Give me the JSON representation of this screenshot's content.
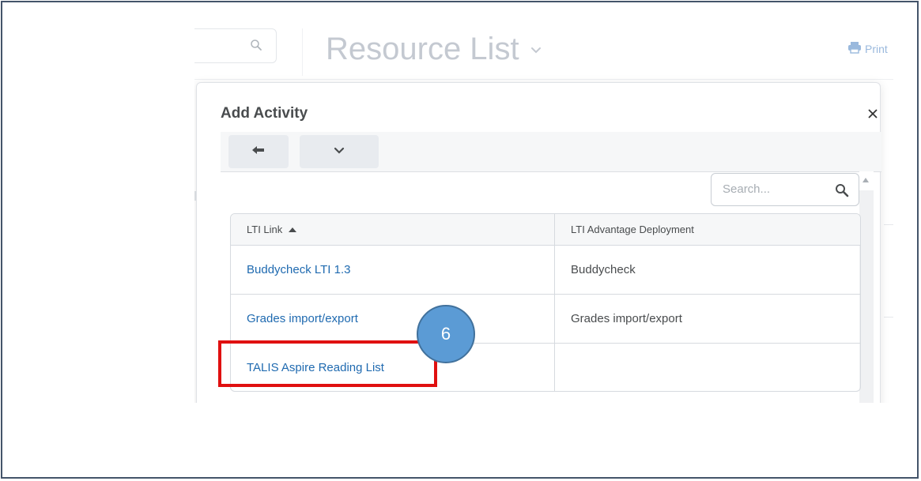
{
  "page": {
    "title": "Resource List",
    "print_label": "Print"
  },
  "dialog": {
    "title": "Add Activity",
    "close_glyph": "×",
    "search": {
      "placeholder": "Search...",
      "value": ""
    },
    "table": {
      "columns": [
        {
          "label": "LTI Link",
          "sorted": "ascending"
        },
        {
          "label": "LTI Advantage Deployment"
        }
      ],
      "rows": [
        {
          "link": "Buddycheck LTI 1.3",
          "deployment": "Buddycheck"
        },
        {
          "link": "Grades import/export",
          "deployment": "Grades import/export"
        },
        {
          "link": "TALIS Aspire Reading List",
          "deployment": ""
        }
      ]
    }
  },
  "annotation": {
    "step_number": "6",
    "highlight_color": "#e01010",
    "badge_color": "#5b9bd5"
  },
  "colors": {
    "link": "#1f6ab0",
    "text": "#494c4e",
    "border": "#44546a"
  },
  "icons": [
    "search-icon",
    "chevron-down-icon",
    "printer-icon",
    "close-icon",
    "arrow-left-icon",
    "sort-ascending-icon"
  ]
}
